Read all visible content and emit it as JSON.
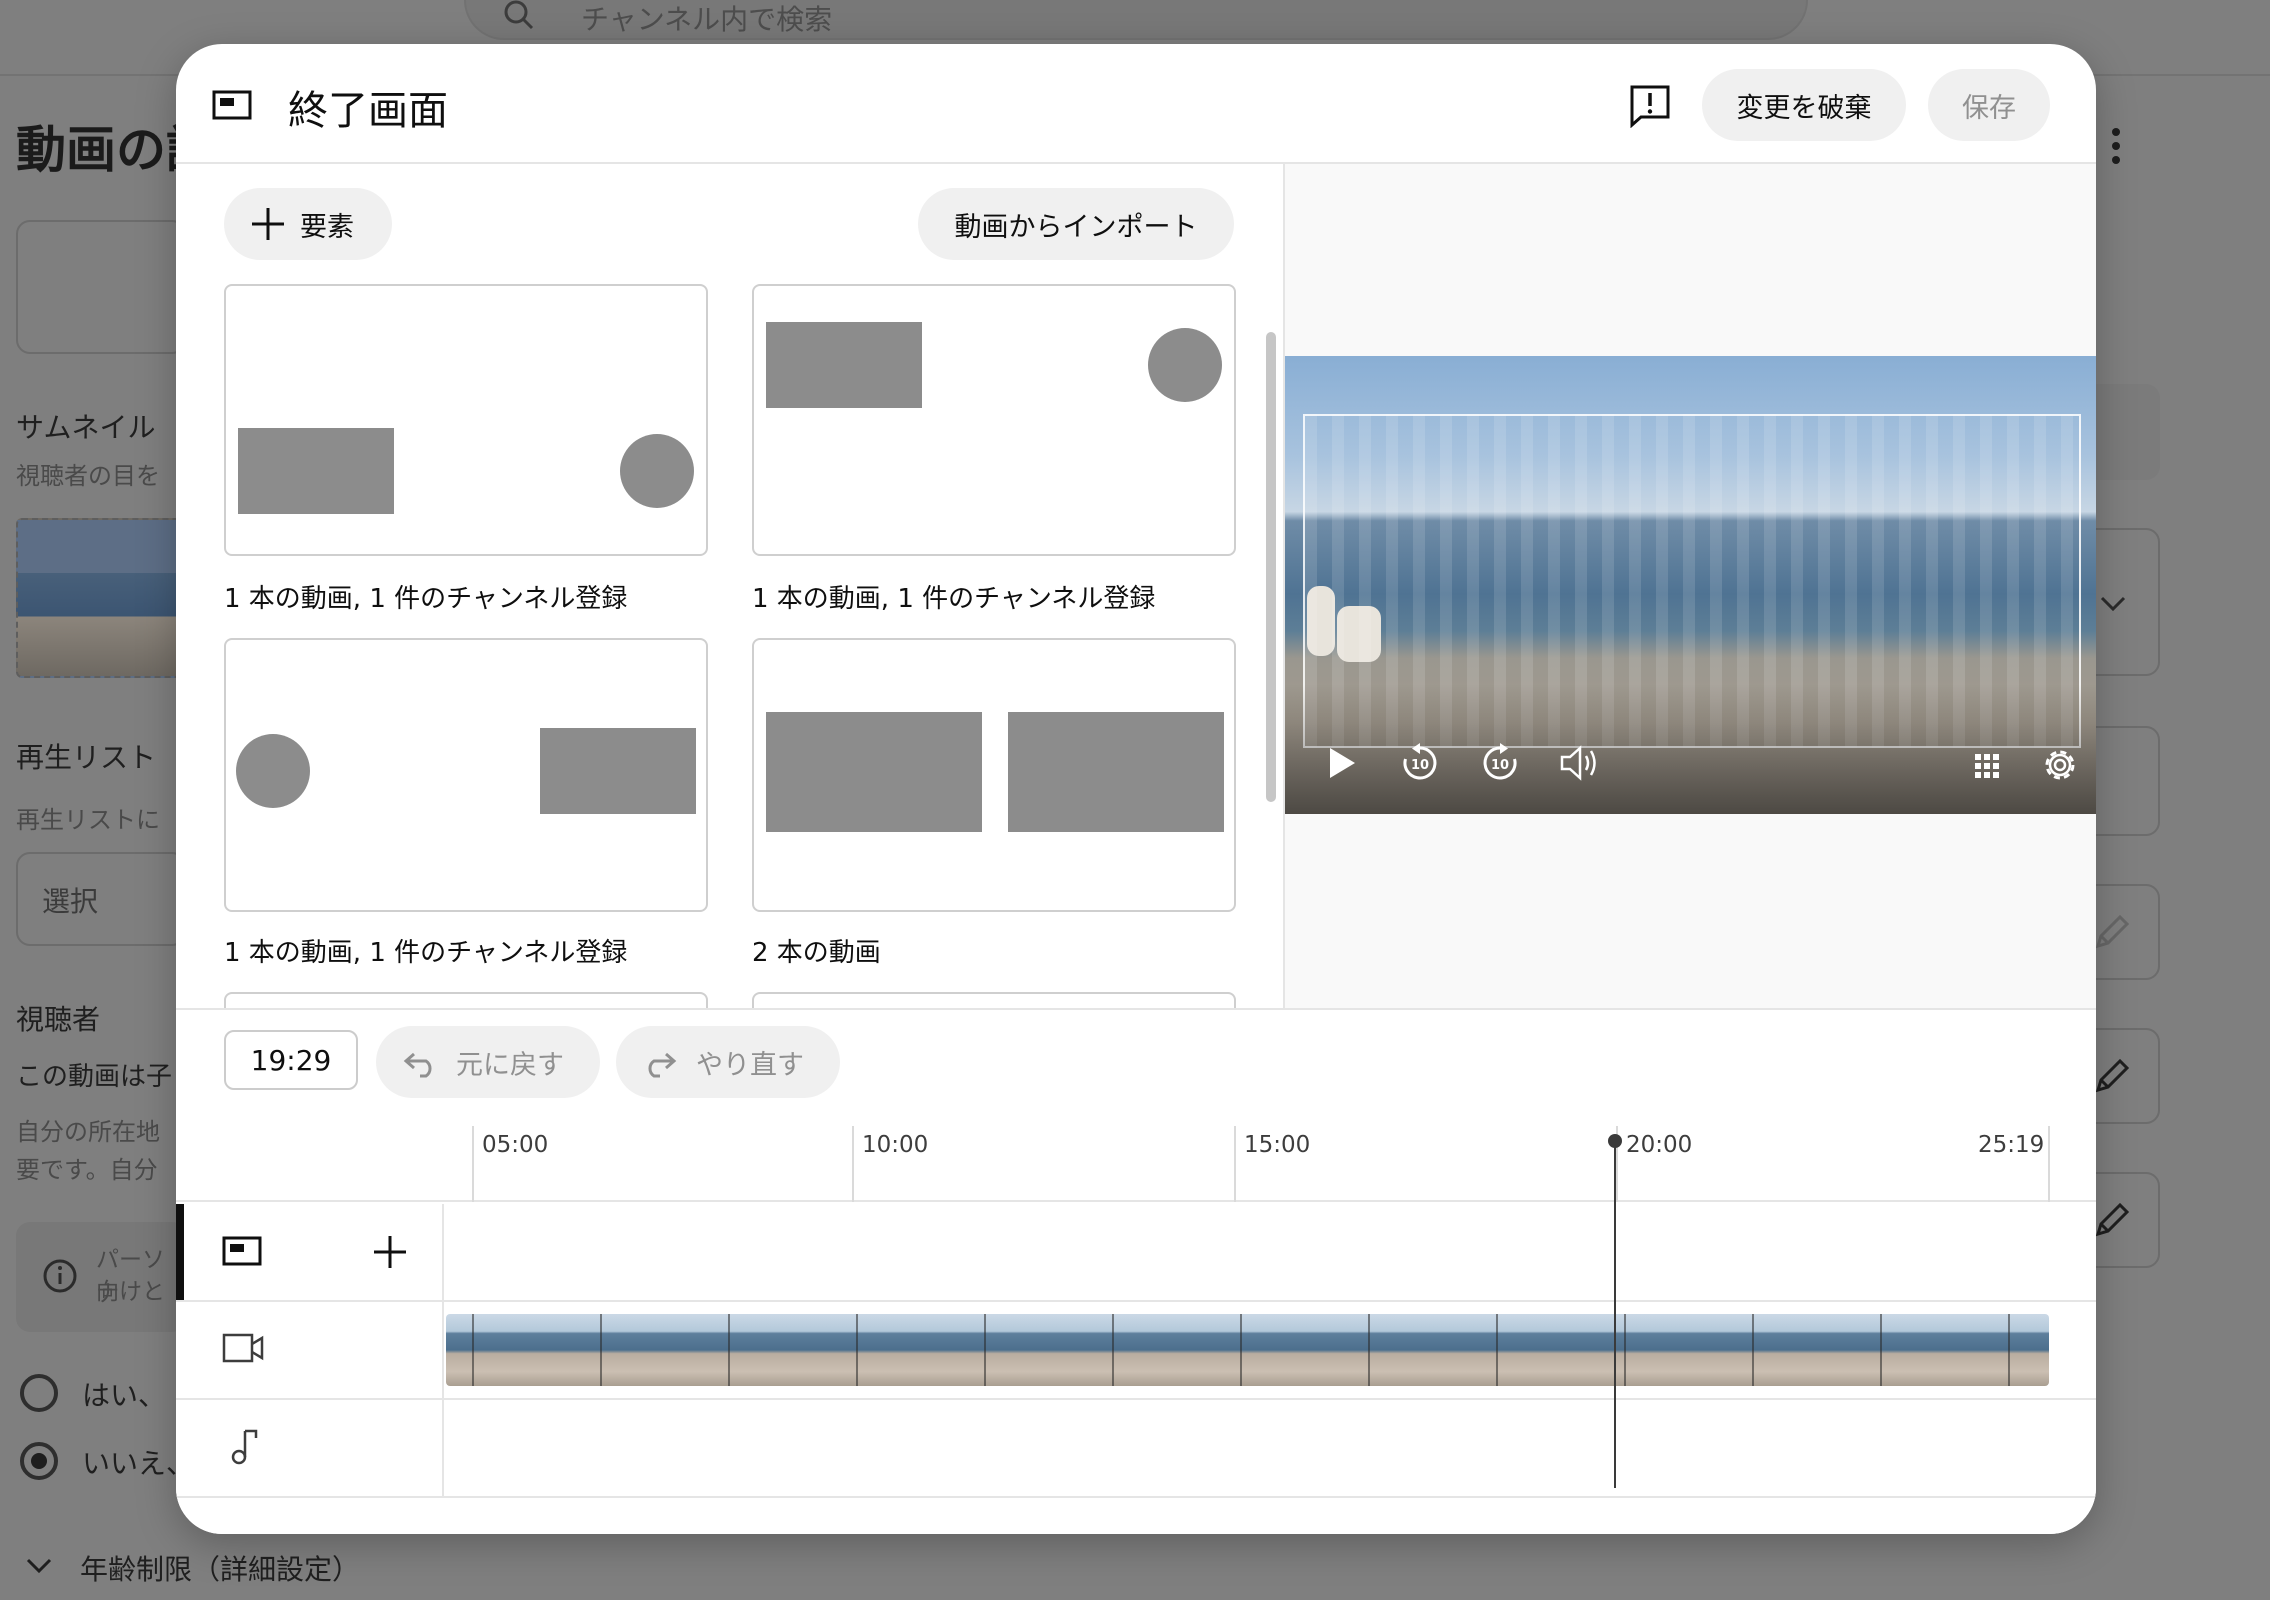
{
  "background": {
    "search_placeholder": "チャンネル内で検索",
    "page_title": "動画の詳",
    "thumbnail_heading": "サムネイル",
    "thumbnail_sub": "視聴者の目を",
    "playlist_heading": "再生リスト",
    "playlist_sub": "再生リストに",
    "playlist_select": "選択",
    "audience_heading": "視聴者",
    "audience_question": "この動画は子",
    "audience_sub_1": "自分の所在地",
    "audience_sub_2": "要です。自分",
    "info_line_1": "パーソナ",
    "info_line_2": "向けと",
    "radio_yes": "はい、",
    "radio_no": "いいえ、",
    "age_restriction": "年齢制限（詳細設定）"
  },
  "modal": {
    "title": "終了画面",
    "discard_button": "変更を破棄",
    "save_button": "保存",
    "add_element_button": "要素",
    "import_button": "動画からインポート",
    "templates": [
      {
        "label": "1 本の動画, 1 件のチャンネル登録"
      },
      {
        "label": "1 本の動画, 1 件のチャンネル登録"
      },
      {
        "label": "1 本の動画, 1 件のチャンネル登録"
      },
      {
        "label": "2 本の動画"
      }
    ],
    "timeline": {
      "current_time": "19:29",
      "undo_button": "元に戻す",
      "redo_button": "やり直す",
      "ticks": [
        "05:00",
        "10:00",
        "15:00",
        "20:00",
        "25:19"
      ]
    }
  },
  "icons": {
    "title": "end-screen-icon",
    "feedback": "feedback-icon",
    "add": "plus-icon",
    "play": "play-icon",
    "rewind": "rewind-10-icon",
    "forward": "forward-10-icon",
    "volume": "volume-icon",
    "grid": "grid-icon",
    "settings": "gear-icon",
    "video_track": "video-camera-icon",
    "audio_track": "music-note-icon"
  }
}
